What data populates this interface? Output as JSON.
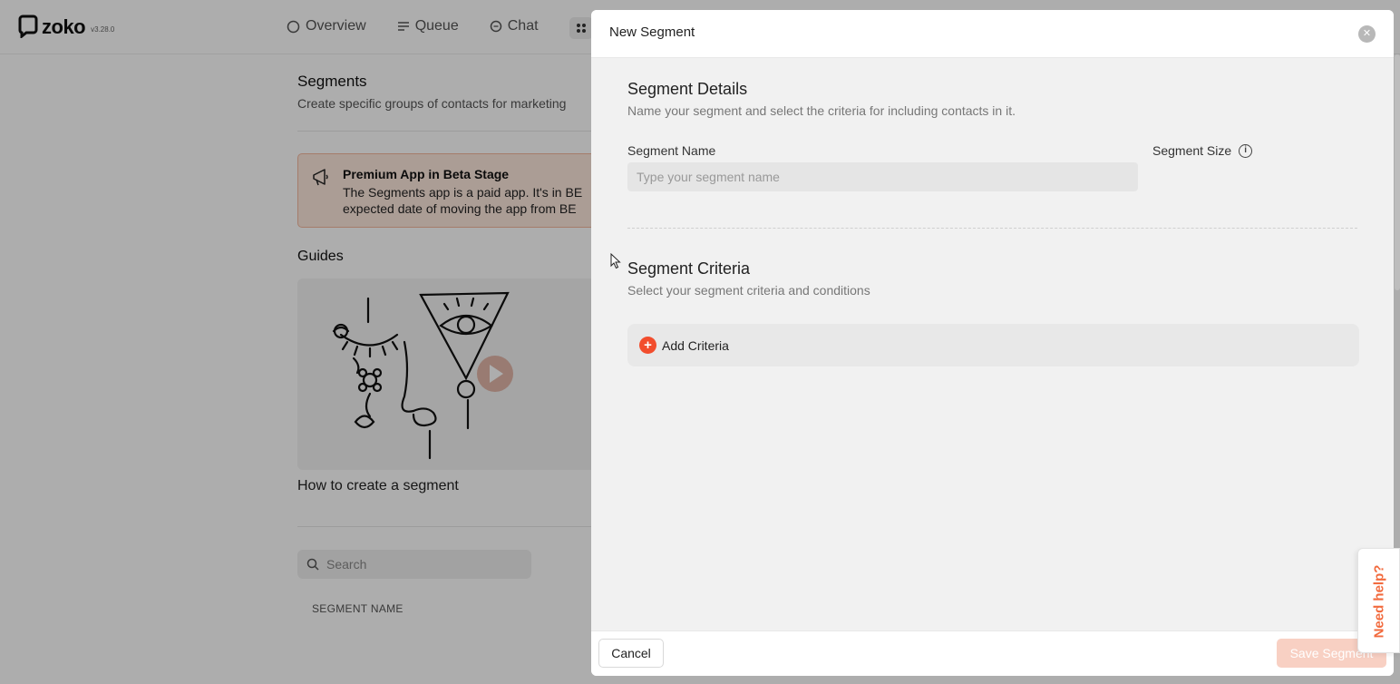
{
  "app": {
    "name": "zoko",
    "version": "v3.28.0"
  },
  "nav": {
    "items": [
      {
        "label": "Overview",
        "icon": "circle-icon"
      },
      {
        "label": "Queue",
        "icon": "queue-list-icon"
      },
      {
        "label": "Chat",
        "icon": "chat-bubble-icon"
      }
    ],
    "apps_icon": "grid-icon"
  },
  "background": {
    "title": "Segments",
    "subtitle": "Create specific groups of contacts for marketing",
    "beta_banner": {
      "icon": "megaphone-icon",
      "title": "Premium App in Beta Stage",
      "line1": "The Segments app is a paid app. It's in BE",
      "line2": "expected date of moving the app from BE"
    },
    "guides_title": "Guides",
    "guide_caption": "How to create a segment",
    "search_placeholder": "Search",
    "table_header": "SEGMENT NAME"
  },
  "modal": {
    "title": "New Segment",
    "details": {
      "title": "Segment Details",
      "subtitle": "Name your segment and select the criteria for including contacts in it.",
      "name_label": "Segment Name",
      "name_placeholder": "Type your segment name",
      "name_value": "",
      "size_label": "Segment Size"
    },
    "criteria": {
      "title": "Segment Criteria",
      "subtitle": "Select your segment criteria and conditions",
      "add_label": "Add Criteria"
    },
    "footer": {
      "cancel_label": "Cancel",
      "save_label": "Save Segment"
    }
  },
  "help": {
    "label": "Need help?"
  },
  "colors": {
    "accent": "#f24d2d",
    "banner_bg": "#fde7dc",
    "save_disabled": "#f8d0c3"
  }
}
